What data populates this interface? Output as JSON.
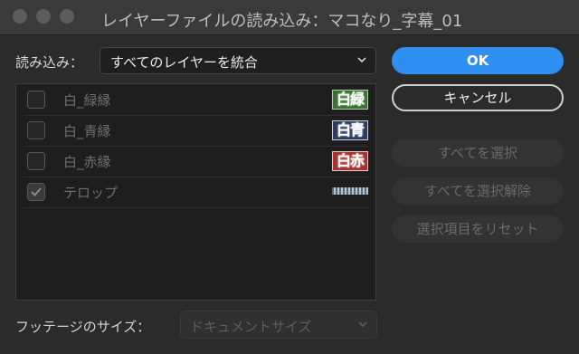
{
  "window": {
    "title": "レイヤーファイルの読み込み：マコなり_字幕_01"
  },
  "import": {
    "label": "読み込み：",
    "selected": "すべてのレイヤーを統合"
  },
  "layers": [
    {
      "name": "白_緑縁",
      "checked": false,
      "thumb_text": "白緑",
      "thumb_bg": "#3f6e3a",
      "thumb_border": "#a9d79d"
    },
    {
      "name": "白_青縁",
      "checked": false,
      "thumb_text": "白青",
      "thumb_bg": "#2e3b5c",
      "thumb_border": "#c9d2e8"
    },
    {
      "name": "白_赤縁",
      "checked": false,
      "thumb_text": "白赤",
      "thumb_bg": "#a83030",
      "thumb_border": "#f0c8c8"
    },
    {
      "name": "テロップ",
      "checked": true,
      "thumb_text": "",
      "thumb_bg": "",
      "thumb_border": ""
    }
  ],
  "buttons": {
    "ok": "OK",
    "cancel": "キャンセル",
    "select_all": "すべてを選択",
    "deselect_all": "すべてを選択解除",
    "reset_selection": "選択項目をリセット"
  },
  "footage": {
    "label": "フッテージのサイズ：",
    "selected": "ドキュメントサイズ"
  },
  "colors": {
    "accent": "#2f8ff0",
    "background": "#2b2b2b"
  }
}
